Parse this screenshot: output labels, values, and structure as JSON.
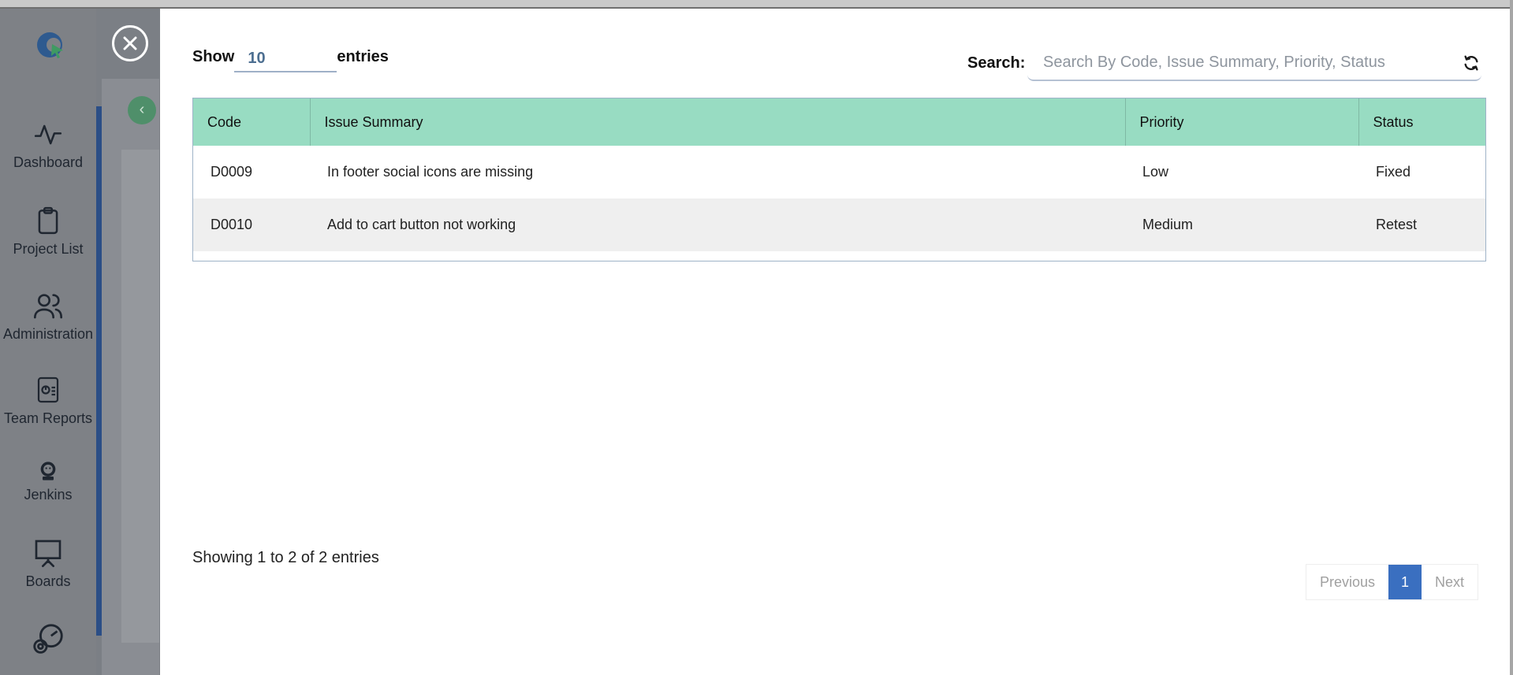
{
  "nav": {
    "items": [
      {
        "label": "Dashboard",
        "icon": "activity-icon"
      },
      {
        "label": "Project List",
        "icon": "clipboard-icon"
      },
      {
        "label": "Administration",
        "icon": "users-icon"
      },
      {
        "label": "Team Reports",
        "icon": "report-icon"
      },
      {
        "label": "Jenkins",
        "icon": "jenkins-icon"
      },
      {
        "label": "Boards",
        "icon": "presentation-board-icon"
      }
    ]
  },
  "modal": {
    "show_label": "Show",
    "entries_value": "10",
    "entries_label": "entries",
    "search_label": "Search:",
    "search_placeholder": "Search By Code, Issue Summary, Priority, Status",
    "columns": [
      "Code",
      "Issue Summary",
      "Priority",
      "Status"
    ],
    "rows": [
      {
        "code": "D0009",
        "summary": "In footer social icons are missing",
        "priority": "Low",
        "status": "Fixed"
      },
      {
        "code": "D0010",
        "summary": "Add to cart button not working",
        "priority": "Medium",
        "status": "Retest"
      }
    ],
    "info": "Showing 1 to 2 of 2 entries",
    "pagination": {
      "previous": "Previous",
      "current": "1",
      "next": "Next"
    }
  },
  "colors": {
    "header_bg": "#98dcc2",
    "active_page": "#3a6fc0",
    "sidebar_accent": "#2b4e86"
  }
}
